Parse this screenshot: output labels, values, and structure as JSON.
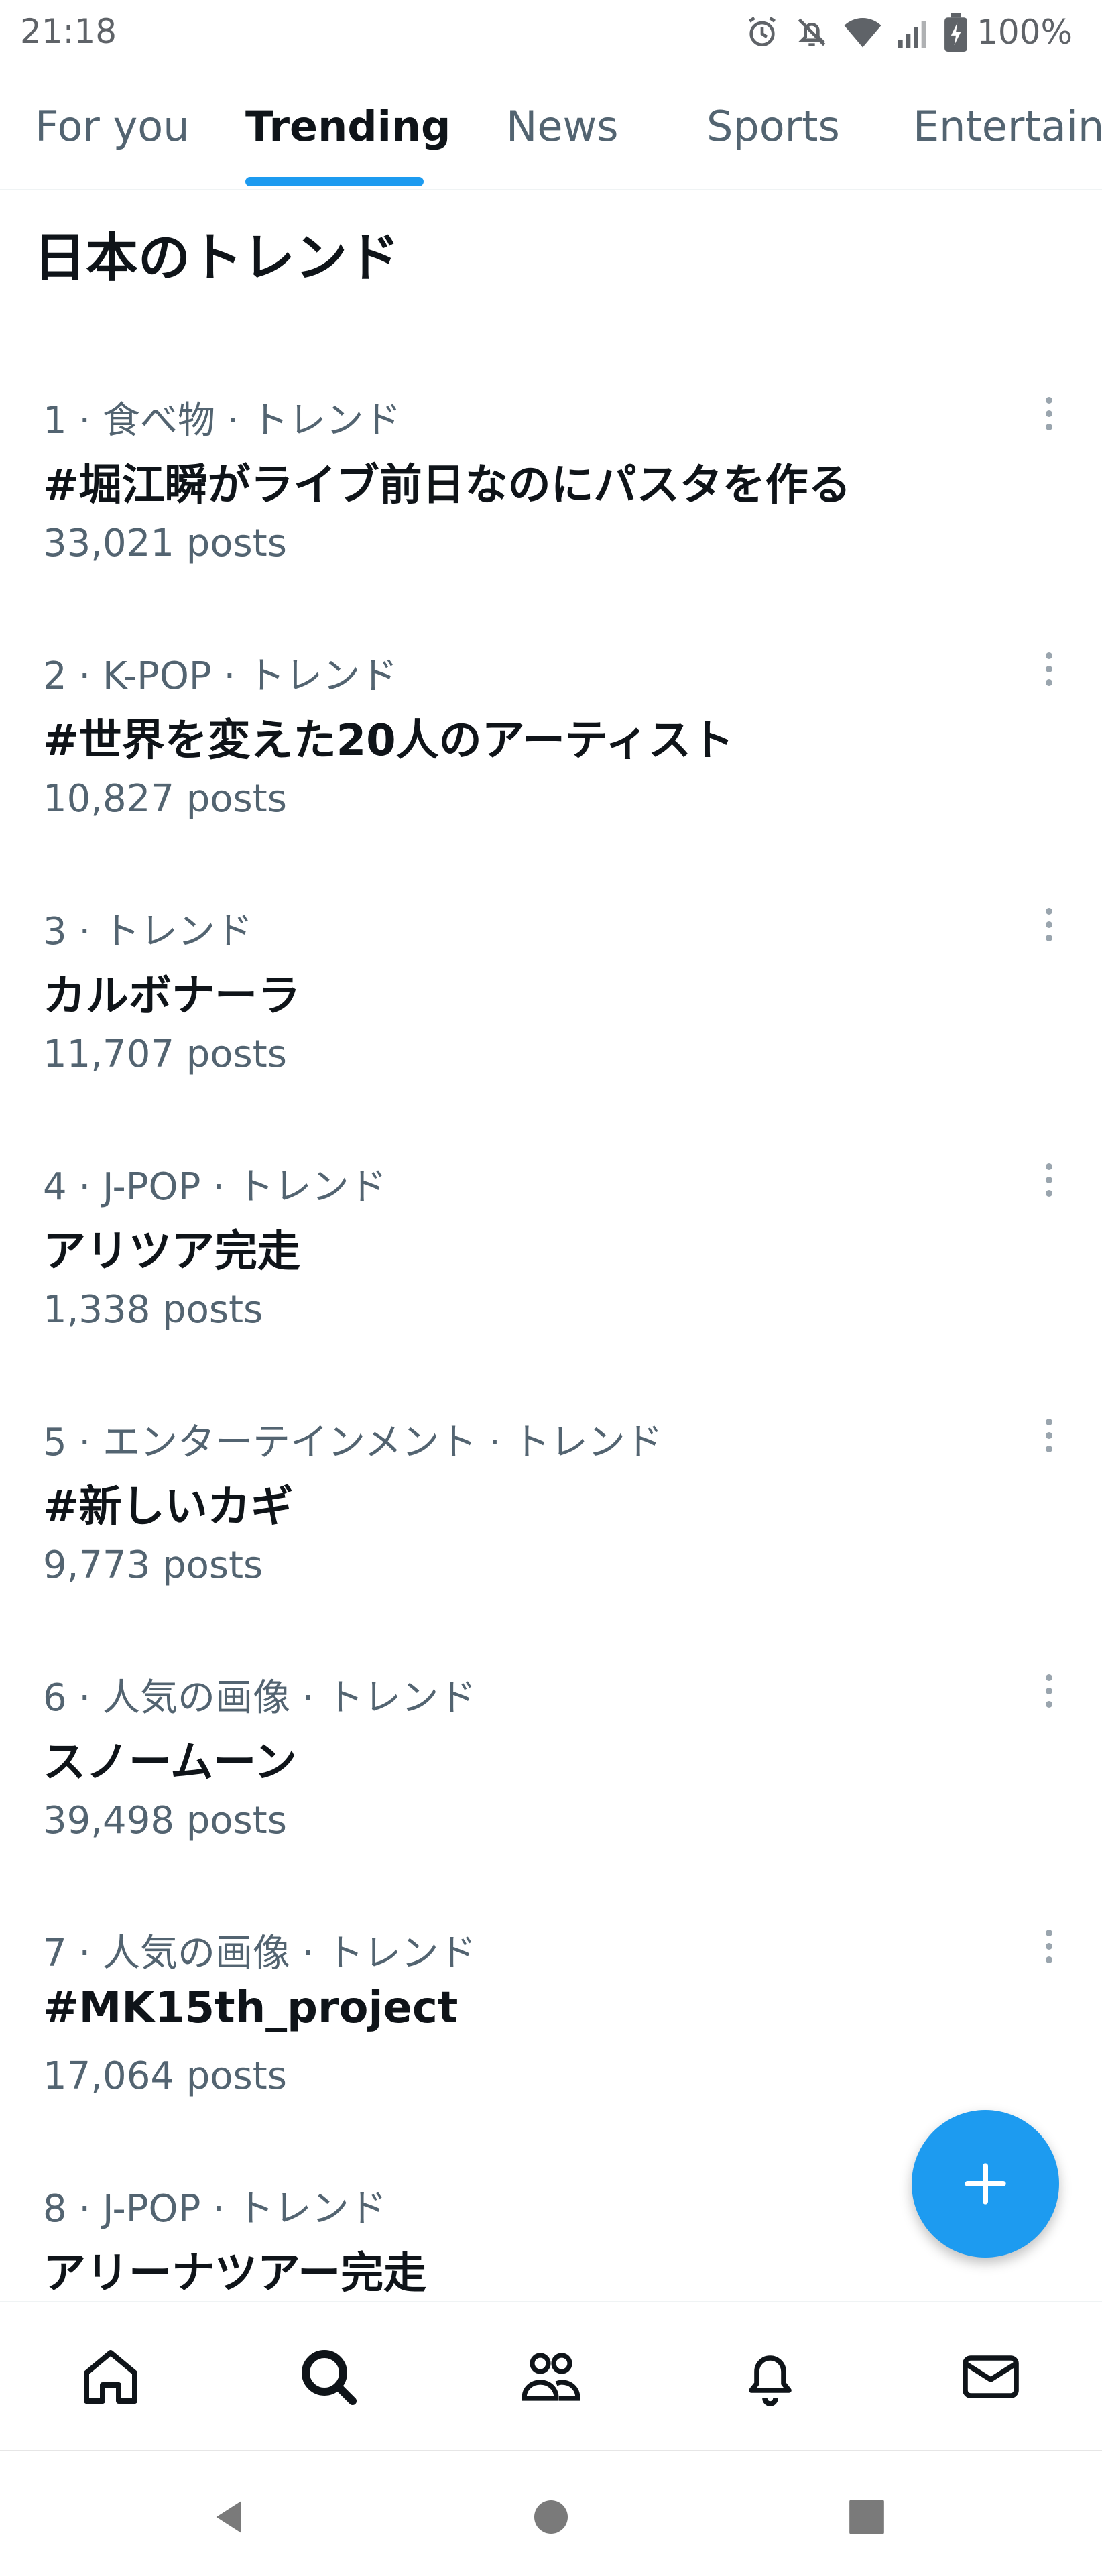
{
  "status_bar": {
    "time": "21:18",
    "battery_text": "100%",
    "icons": [
      "alarm-icon",
      "notifications-muted-icon",
      "wifi-icon",
      "cell-signal-icon",
      "battery-charging-icon"
    ]
  },
  "tabs": [
    {
      "label": "For you"
    },
    {
      "label": "Trending",
      "active": true
    },
    {
      "label": "News"
    },
    {
      "label": "Sports"
    },
    {
      "label": "Entertainment"
    }
  ],
  "section": {
    "title": "日本のトレンド"
  },
  "trends": [
    {
      "meta": "1 · 食べ物 · トレンド",
      "name": "#堀江瞬がライブ前日なのにパスタを作る",
      "posts": "33,021 posts"
    },
    {
      "meta": "2 · K-POP · トレンド",
      "name": "#世界を変えた20人のアーティスト",
      "posts": "10,827 posts"
    },
    {
      "meta": "3 · トレンド",
      "name": "カルボナーラ",
      "posts": "11,707 posts"
    },
    {
      "meta": "4 · J-POP · トレンド",
      "name": "アリツア完走",
      "posts": "1,338 posts"
    },
    {
      "meta": "5 · エンターテインメント · トレンド",
      "name": "#新しいカギ",
      "posts": "9,773 posts"
    },
    {
      "meta": "6 · 人気の画像 · トレンド",
      "name": "スノームーン",
      "posts": "39,498 posts"
    },
    {
      "meta": "7 · 人気の画像 · トレンド",
      "name": "#MK15th_project",
      "posts": "17,064 posts"
    },
    {
      "meta": "8 · J-POP · トレンド",
      "name": "アリーナツアー完走",
      "posts": ""
    }
  ],
  "fab": {
    "icon": "plus-icon"
  },
  "bottom_nav": [
    "home-icon",
    "search-icon",
    "communities-icon",
    "notifications-icon",
    "messages-icon"
  ],
  "system_nav": [
    "back-icon",
    "home-circle-icon",
    "recents-icon"
  ],
  "colors": {
    "accent": "#1d9bf0",
    "text_primary": "#0f1419",
    "text_secondary": "#536471"
  }
}
